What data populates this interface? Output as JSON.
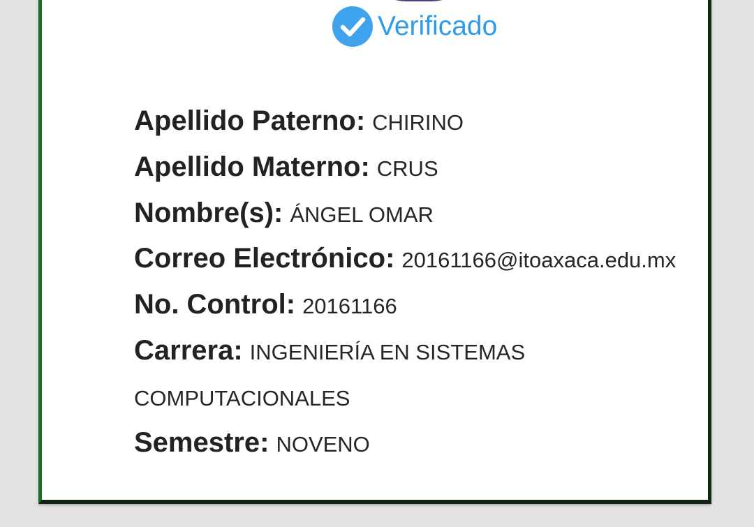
{
  "badge": {
    "label": "Verificado",
    "icon": "check-circle-icon",
    "color": "#2f9be6"
  },
  "fields": [
    {
      "label": "Apellido Paterno:",
      "value": "CHIRINO"
    },
    {
      "label": "Apellido Materno:",
      "value": "CRUS"
    },
    {
      "label": "Nombre(s):",
      "value": "ÁNGEL OMAR"
    },
    {
      "label": "Correo Electrónico:",
      "value": "20161166@itoaxaca.edu.mx"
    },
    {
      "label": "No. Control:",
      "value": "20161166"
    },
    {
      "label": "Carrera:",
      "value": "INGENIERÍA EN SISTEMAS",
      "value_continued": "COMPUTACIONALES"
    },
    {
      "label": "Semestre:",
      "value": "NOVENO"
    }
  ],
  "colors": {
    "card_border": "#1b6e2a",
    "background": "#e3e3e3"
  }
}
